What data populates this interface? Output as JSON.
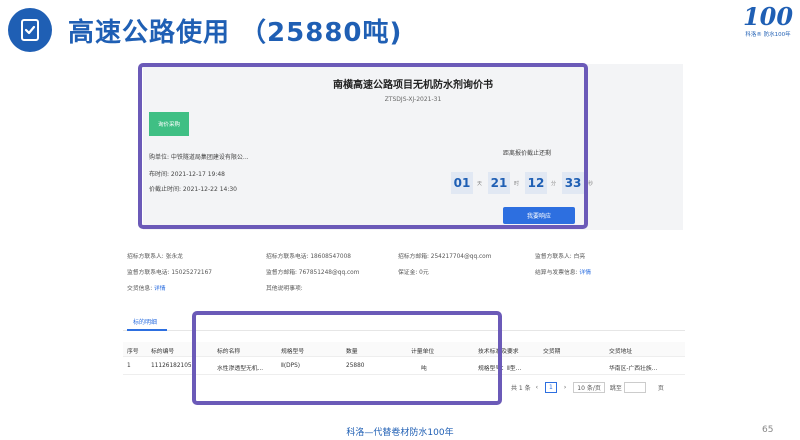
{
  "header": {
    "title": "高速公路使用 （25880吨)",
    "logo_number": "100",
    "logo_caption": "科洛® 防水100年"
  },
  "footer": {
    "slogan": "科洛—代替卷材防水100年",
    "page_number": "65"
  },
  "document": {
    "title": "南横高速公路项目无机防水剂询价书",
    "code": "ZTSDJS-XJ-2021-31",
    "status_tag": "询价采购",
    "info_lines": [
      "购单位:  中铁隧道局集团建设有限公...",
      "布时间:  2021-12-17 19:48",
      "价截止时间:  2021-12-22 14:30"
    ],
    "deadline_label": "距离报价截止还剩",
    "countdown": [
      {
        "value": "01",
        "unit": "天"
      },
      {
        "value": "21",
        "unit": "时"
      },
      {
        "value": "12",
        "unit": "分"
      },
      {
        "value": "33",
        "unit": "秒"
      }
    ],
    "respond_button": "我要响应"
  },
  "contacts": {
    "bidder_contact": "招标方联系人:  张永龙",
    "bidder_phone": "招标方联系电话:  18608547008",
    "bidder_email": "招标方邮箱:  254217704@qq.com",
    "supervisor_contact": "监督方联系人:  白亮",
    "supervisor_phone": "监督方联系电话:  15025272167",
    "supervisor_email": "监督方邮箱:  767851248@qq.com",
    "deposit": "保证金:  0元",
    "settlement_label": "结算与发票信息:",
    "settlement_link": "详情",
    "delivery_label": "交货信息:",
    "delivery_link": "详情",
    "other_notes": "其他说明事项:"
  },
  "table": {
    "tab_label": "标的明细",
    "columns": [
      "序号",
      "标的编号",
      "标的名称",
      "规格型号",
      "数量",
      "计量单位",
      "技术标准及要求",
      "交货期",
      "交货地址"
    ],
    "rows": [
      [
        "1",
        "111261821056",
        "水性渗透型无机...",
        "Ⅱ(DPS)",
        "25880",
        "吨",
        "规格型号：Ⅱ型...",
        "",
        "华南区-广西壮族..."
      ]
    ]
  },
  "pagination": {
    "total": "共 1 条",
    "prev": "‹",
    "current": "1",
    "next": "›",
    "page_size": "10 条/页",
    "jump_label": "跳至",
    "page_suffix": "页"
  },
  "colors": {
    "brand_blue": "#1f5fb4",
    "highlight_purple": "#6b5ab8",
    "status_green": "#3fbf84",
    "button_blue": "#2d6fe0"
  }
}
